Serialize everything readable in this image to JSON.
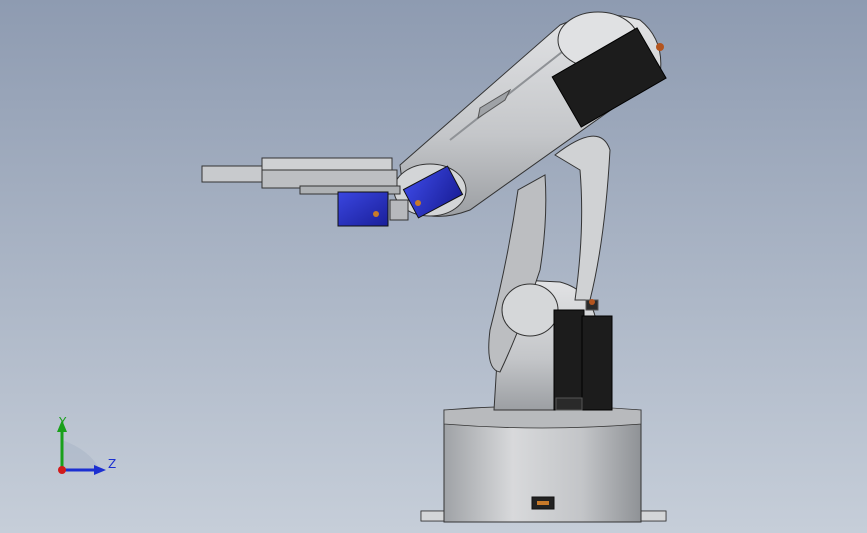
{
  "viewport": {
    "background_top": "#8e9bb1",
    "background_bottom": "#c6ced9"
  },
  "model": {
    "body_color": "#c9cbce",
    "servo_black": "#1c1c1c",
    "servo_blue": "#2430c8"
  },
  "triad": {
    "x_color": "#d11b1b",
    "y_color": "#19a01b",
    "z_color": "#1b2fd1",
    "y_label": "Y",
    "z_label": "Z"
  }
}
